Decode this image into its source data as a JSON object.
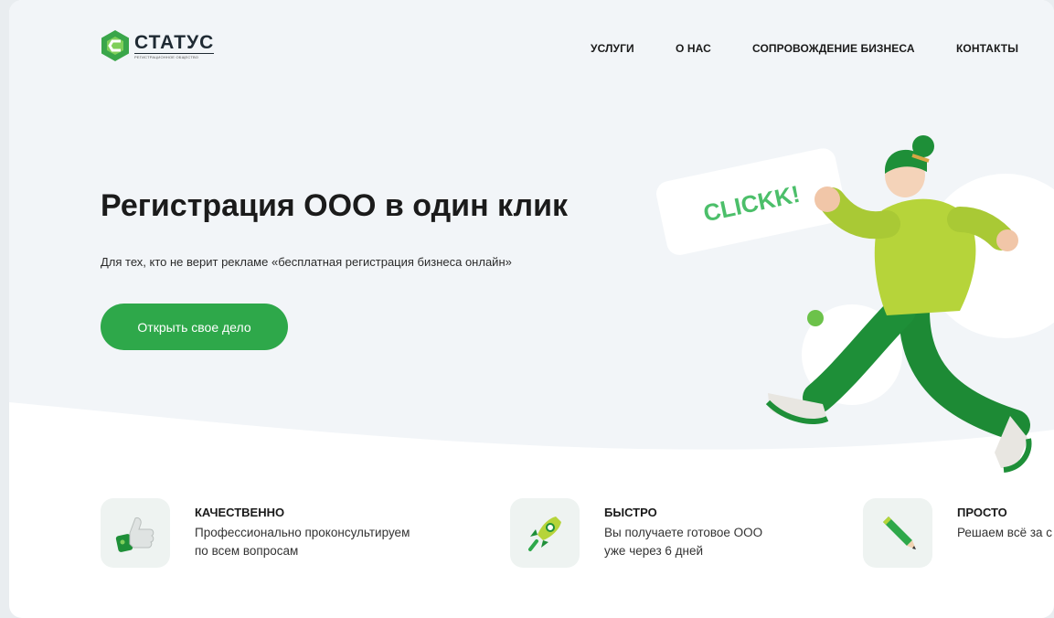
{
  "brand": {
    "name": "СТАТУС",
    "tagline": "РЕГИСТРАЦИОННОЕ ОБЩЕСТВО",
    "color": "#3aa64a"
  },
  "nav": {
    "items": [
      {
        "label": "УСЛУГИ"
      },
      {
        "label": "О НАС"
      },
      {
        "label": "СОПРОВОЖДЕНИЕ БИЗНЕСА"
      },
      {
        "label": "КОНТАКТЫ"
      }
    ]
  },
  "hero": {
    "title": "Регистрация ООО в один клик",
    "subtitle": "Для тех, кто не верит рекламе «бесплатная регистрация бизнеса онлайн»",
    "cta_label": "Открыть свое дело",
    "sign_text": "CLICKK!",
    "accent": "#2ea84a"
  },
  "features": [
    {
      "icon": "thumbs-up-icon",
      "title": "КАЧЕСТВЕННО",
      "desc_line1": "Профессионально проконсультируем",
      "desc_line2": "по всем вопросам"
    },
    {
      "icon": "rocket-icon",
      "title": "БЫСТРО",
      "desc_line1": "Вы получаете готовое ООО",
      "desc_line2": "уже через 6 дней"
    },
    {
      "icon": "pencil-icon",
      "title": "ПРОСТО",
      "desc_line1": "Решаем всё за с",
      "desc_line2": ""
    }
  ]
}
